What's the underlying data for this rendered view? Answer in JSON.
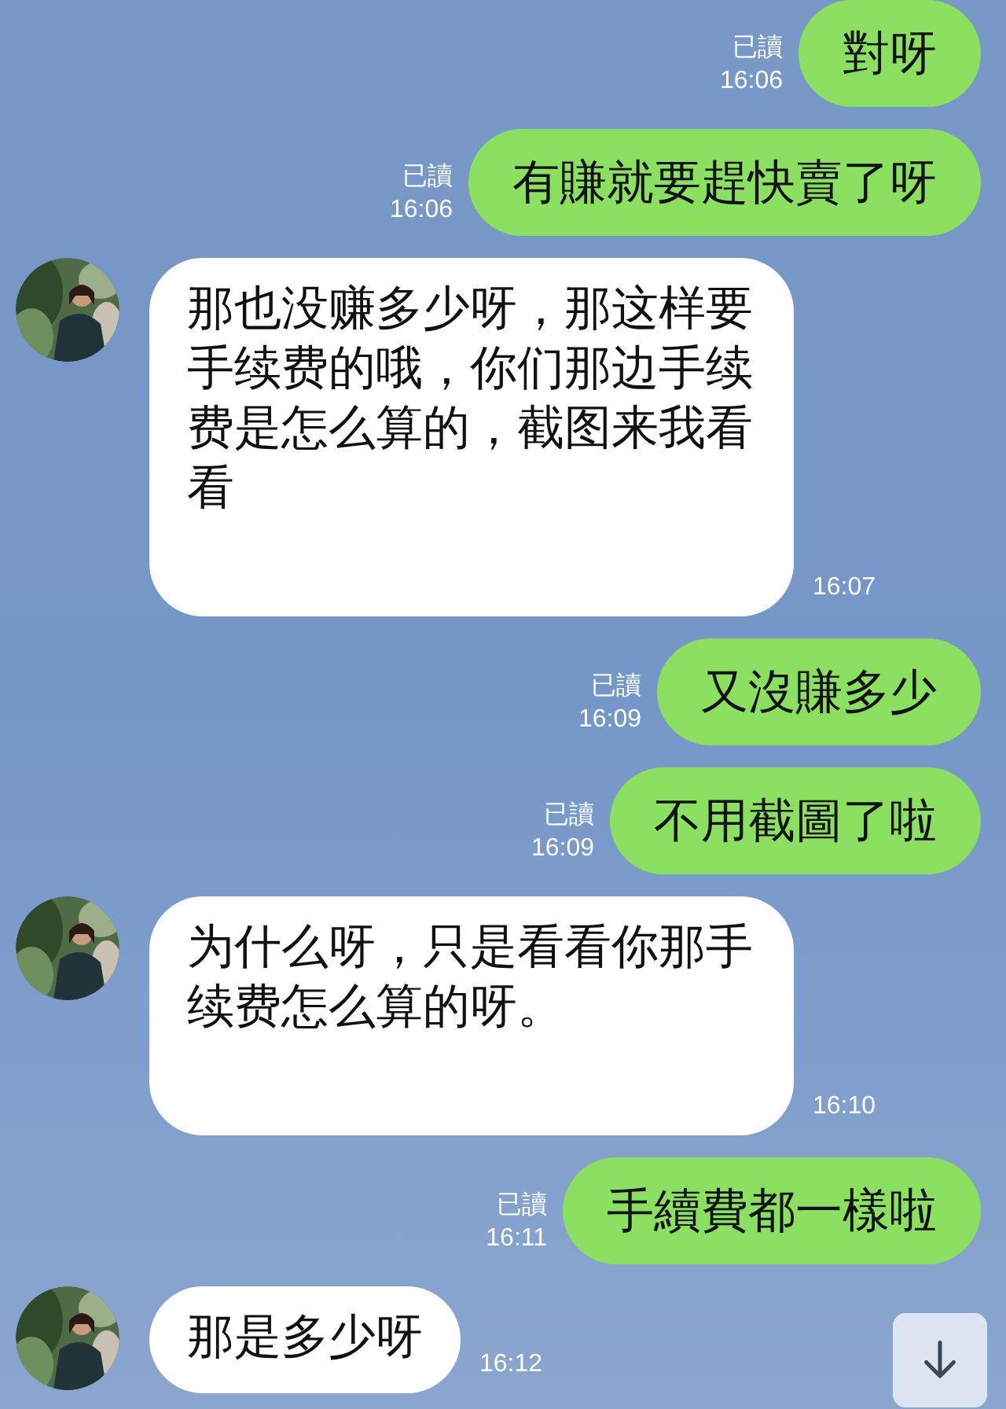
{
  "messages": [
    {
      "kind": "sent",
      "text": "對呀",
      "read": "已讀",
      "time": "16:06"
    },
    {
      "kind": "sent",
      "text": "有賺就要趕快賣了呀",
      "read": "已讀",
      "time": "16:06"
    },
    {
      "kind": "received",
      "text": "那也没赚多少呀，那这样要手续费的哦，你们那边手续费是怎么算的，截图来我看看",
      "time": "16:07"
    },
    {
      "kind": "sent",
      "text": "又沒賺多少",
      "read": "已讀",
      "time": "16:09"
    },
    {
      "kind": "sent",
      "text": "不用截圖了啦",
      "read": "已讀",
      "time": "16:09"
    },
    {
      "kind": "received",
      "text": "为什么呀，只是看看你那手续费怎么算的呀。",
      "time": "16:10"
    },
    {
      "kind": "sent",
      "text": "手續費都一樣啦",
      "read": "已讀",
      "time": "16:11"
    },
    {
      "kind": "received",
      "text": "那是多少呀",
      "time": "16:12"
    }
  ]
}
